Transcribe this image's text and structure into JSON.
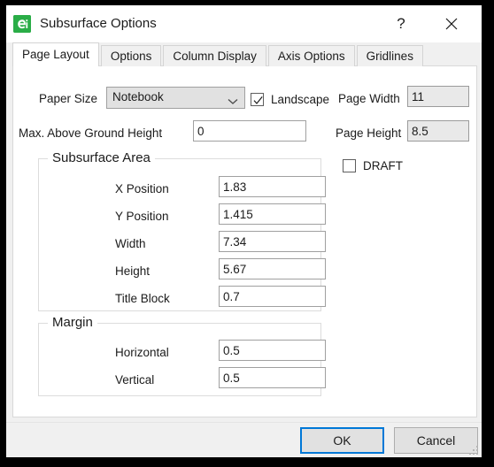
{
  "window": {
    "title": "Subsurface Options",
    "app_icon": "app-logo-icon",
    "help_label": "?",
    "close_label": "close-icon"
  },
  "tabs": [
    {
      "label": "Page Layout",
      "active": true
    },
    {
      "label": "Options",
      "active": false
    },
    {
      "label": "Column Display",
      "active": false
    },
    {
      "label": "Axis Options",
      "active": false
    },
    {
      "label": "Gridlines",
      "active": false
    }
  ],
  "page_layout": {
    "paper_size": {
      "label": "Paper Size",
      "value": "Notebook"
    },
    "landscape": {
      "label": "Landscape",
      "checked": true
    },
    "page_width": {
      "label": "Page Width",
      "value": "11",
      "readonly": true
    },
    "max_above_ground_height": {
      "label": "Max. Above Ground Height",
      "value": "0",
      "readonly": false
    },
    "page_height": {
      "label": "Page Height",
      "value": "8.5",
      "readonly": true
    },
    "draft": {
      "label": "DRAFT",
      "checked": false
    },
    "subsurface_area": {
      "legend": "Subsurface Area",
      "fields": [
        {
          "label": "X Position",
          "value": "1.83"
        },
        {
          "label": "Y Position",
          "value": "1.415"
        },
        {
          "label": "Width",
          "value": "7.34"
        },
        {
          "label": "Height",
          "value": "5.67"
        },
        {
          "label": "Title Block",
          "value": "0.7"
        }
      ]
    },
    "margin": {
      "legend": "Margin",
      "fields": [
        {
          "label": "Horizontal",
          "value": "0.5"
        },
        {
          "label": "Vertical",
          "value": "0.5"
        }
      ]
    }
  },
  "footer": {
    "ok_label": "OK",
    "cancel_label": "Cancel"
  },
  "colors": {
    "accent": "#0078d7",
    "icon_green": "#2aad47",
    "dialog_bg": "#f0f0f0",
    "panel_bg": "#ffffff"
  }
}
